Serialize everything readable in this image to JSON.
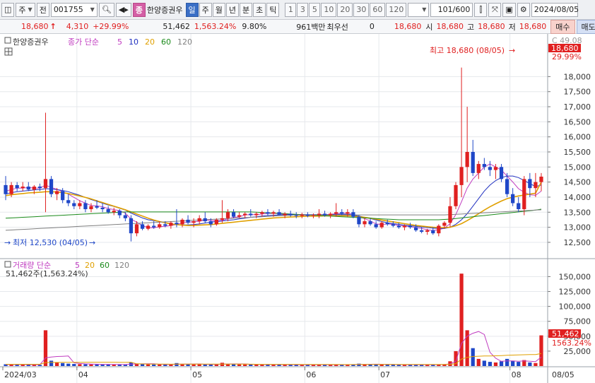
{
  "toolbar": {
    "type_label": "주",
    "period_prefix": "전",
    "code": "001755",
    "name_badge": "종",
    "stock_name": "한양증권우",
    "periods": [
      "일",
      "주",
      "월",
      "년",
      "분",
      "초",
      "틱"
    ],
    "active_period": "일",
    "intervals": [
      "1",
      "3",
      "5",
      "10",
      "20",
      "30",
      "60",
      "120"
    ],
    "count_display": "101/600",
    "date": "2024/08/05"
  },
  "info": {
    "price": "18,680",
    "change": "4,310",
    "change_pct": "+29.99%",
    "volume": "51,462",
    "volume_ratio": "1,563.24%",
    "turnover": "9.80%",
    "amount": "961백만",
    "bid_label": "최우선",
    "bid_value": "0",
    "ask_value": "18,680",
    "open_label": "시",
    "open": "18,680",
    "high_label": "고",
    "high": "18,680",
    "low_label": "저",
    "low": "18,680",
    "buy_button": "매수",
    "sell_button": "매도"
  },
  "price_panel": {
    "title": "한양증권우",
    "ma_label": "종가 단순",
    "ma_periods": [
      "5",
      "10",
      "20",
      "60",
      "120"
    ],
    "ma_colors": [
      "#c03cc0",
      "#2030c0",
      "#e0a000",
      "#1a8a1a",
      "#808080"
    ],
    "high_annotation": "최고 18,680 (08/05)",
    "low_annotation": "최저 12,530 (04/05)",
    "current_price_tag": "18,680",
    "current_pct_tag": "29.99%",
    "top_label": "C 49.08"
  },
  "volume_panel": {
    "ma_label": "거래량 단순",
    "ma_periods": [
      "5",
      "20",
      "60",
      "120"
    ],
    "summary": "51,462주(1,563.24%)",
    "current_volume_tag": "51,462",
    "current_pct_tag": "1563.24%"
  },
  "x_axis": {
    "labels": [
      "2024/03",
      "04",
      "05",
      "06",
      "07",
      "08"
    ],
    "right_label": "08/05"
  },
  "chart_data": {
    "type": "candlestick",
    "price_axis": {
      "ticks": [
        12500,
        13000,
        13500,
        14000,
        14500,
        15000,
        15500,
        16000,
        16500,
        17000,
        17500,
        18000
      ],
      "tick_labels": [
        "12,500",
        "13,000",
        "13,500",
        "14,000",
        "14,500",
        "15,000",
        "15,500",
        "16,000",
        "16,500",
        "17,000",
        "17,500",
        "18,000"
      ],
      "range": [
        12100,
        18900
      ]
    },
    "volume_axis": {
      "ticks": [
        25000,
        50000,
        75000,
        100000,
        125000,
        150000
      ],
      "tick_labels": [
        "25,000",
        "50,000",
        "75,000",
        "100,000",
        "125,000",
        "150,000"
      ],
      "range": [
        0,
        160000
      ]
    },
    "candles": [
      [
        14400,
        14700,
        13900,
        14100
      ],
      [
        14100,
        14500,
        14000,
        14400
      ],
      [
        14400,
        14500,
        14200,
        14300
      ],
      [
        14300,
        14500,
        14200,
        14350
      ],
      [
        14350,
        14500,
        14200,
        14250
      ],
      [
        14250,
        14400,
        14100,
        14350
      ],
      [
        14350,
        14450,
        14200,
        14300
      ],
      [
        14300,
        16800,
        13500,
        14600
      ],
      [
        14600,
        14700,
        14000,
        14100
      ],
      [
        14100,
        14300,
        13900,
        14200
      ],
      [
        14200,
        14300,
        13800,
        13900
      ],
      [
        13900,
        14100,
        13700,
        13800
      ],
      [
        13800,
        13900,
        13600,
        13700
      ],
      [
        13700,
        13900,
        13600,
        13800
      ],
      [
        13800,
        13900,
        13500,
        13600
      ],
      [
        13600,
        13800,
        13500,
        13700
      ],
      [
        13700,
        13900,
        13600,
        13650
      ],
      [
        13650,
        13800,
        13500,
        13600
      ],
      [
        13600,
        13700,
        13450,
        13500
      ],
      [
        13500,
        13650,
        13400,
        13550
      ],
      [
        13550,
        13600,
        13300,
        13400
      ],
      [
        13400,
        13500,
        13200,
        13300
      ],
      [
        13300,
        13400,
        12530,
        12800
      ],
      [
        12800,
        13200,
        12700,
        13100
      ],
      [
        13100,
        13200,
        12900,
        12950
      ],
      [
        12950,
        13100,
        12900,
        13050
      ],
      [
        13050,
        13200,
        12950,
        13000
      ],
      [
        13000,
        13200,
        12950,
        13100
      ],
      [
        13100,
        13200,
        13000,
        13050
      ],
      [
        13050,
        13200,
        12950,
        13150
      ],
      [
        13150,
        13600,
        13000,
        13100
      ],
      [
        13100,
        13300,
        13000,
        13250
      ],
      [
        13250,
        13400,
        13100,
        13150
      ],
      [
        13150,
        13300,
        13000,
        13200
      ],
      [
        13200,
        13400,
        13100,
        13300
      ],
      [
        13300,
        13500,
        13150,
        13200
      ],
      [
        13200,
        13300,
        13000,
        13100
      ],
      [
        13100,
        13300,
        13050,
        13250
      ],
      [
        13250,
        13900,
        13150,
        13300
      ],
      [
        13300,
        13600,
        13200,
        13500
      ],
      [
        13500,
        13600,
        13300,
        13350
      ],
      [
        13350,
        13500,
        13300,
        13400
      ],
      [
        13400,
        13500,
        13300,
        13450
      ],
      [
        13450,
        13600,
        13350,
        13400
      ],
      [
        13400,
        13500,
        13300,
        13450
      ],
      [
        13450,
        13550,
        13350,
        13500
      ],
      [
        13500,
        13600,
        13400,
        13450
      ],
      [
        13450,
        13550,
        13350,
        13500
      ],
      [
        13500,
        13600,
        13400,
        13400
      ],
      [
        13400,
        13500,
        13300,
        13450
      ],
      [
        13450,
        13550,
        13350,
        13400
      ],
      [
        13400,
        13500,
        13300,
        13380
      ],
      [
        13380,
        13480,
        13300,
        13420
      ],
      [
        13420,
        13500,
        13330,
        13380
      ],
      [
        13380,
        13460,
        13300,
        13400
      ],
      [
        13400,
        13600,
        13300,
        13450
      ],
      [
        13450,
        13550,
        13350,
        13400
      ],
      [
        13400,
        13500,
        13300,
        13450
      ],
      [
        13450,
        13800,
        13350,
        13500
      ],
      [
        13500,
        13600,
        13400,
        13450
      ],
      [
        13450,
        13600,
        13350,
        13500
      ],
      [
        13500,
        13600,
        13300,
        13350
      ],
      [
        13350,
        13400,
        13000,
        13100
      ],
      [
        13100,
        13300,
        13000,
        13200
      ],
      [
        13200,
        13300,
        13050,
        13100
      ],
      [
        13100,
        13200,
        12950,
        13000
      ],
      [
        13000,
        13200,
        12950,
        13150
      ],
      [
        13150,
        13250,
        13050,
        13100
      ],
      [
        13100,
        13200,
        13000,
        13050
      ],
      [
        13050,
        13150,
        12950,
        13000
      ],
      [
        13000,
        13100,
        12900,
        13050
      ],
      [
        13050,
        13150,
        12950,
        13000
      ],
      [
        13000,
        13100,
        12850,
        12900
      ],
      [
        12900,
        13000,
        12800,
        12850
      ],
      [
        12850,
        12950,
        12750,
        12900
      ],
      [
        12900,
        13000,
        12750,
        12800
      ],
      [
        12800,
        13100,
        12700,
        13050
      ],
      [
        13050,
        13200,
        12950,
        13150
      ],
      [
        13150,
        14000,
        13000,
        13700
      ],
      [
        13700,
        14500,
        13600,
        14400
      ],
      [
        14400,
        18300,
        14000,
        15000
      ],
      [
        15000,
        17000,
        14500,
        15500
      ],
      [
        15500,
        15900,
        14700,
        14800
      ],
      [
        14800,
        15200,
        14600,
        15100
      ],
      [
        15100,
        15300,
        14900,
        15000
      ],
      [
        15000,
        15200,
        14700,
        14900
      ],
      [
        14900,
        15100,
        14600,
        15000
      ],
      [
        15000,
        15100,
        14500,
        14600
      ],
      [
        14600,
        14800,
        14000,
        14100
      ],
      [
        14100,
        14300,
        13700,
        13800
      ],
      [
        13800,
        14000,
        13500,
        13600
      ],
      [
        13600,
        14700,
        13400,
        14600
      ],
      [
        14600,
        14800,
        14000,
        14300
      ],
      [
        14300,
        14800,
        14000,
        14500
      ],
      [
        14500,
        14800,
        14200,
        14680
      ]
    ],
    "volume": [
      3000,
      2500,
      2200,
      2500,
      2000,
      2200,
      2000,
      60000,
      9000,
      6000,
      5000,
      4000,
      3500,
      3200,
      3000,
      2800,
      3000,
      2600,
      2500,
      2400,
      2600,
      2500,
      6000,
      4000,
      3000,
      2800,
      2700,
      2600,
      2500,
      2600,
      5000,
      3200,
      3000,
      2800,
      2900,
      2700,
      2600,
      2500,
      5500,
      3500,
      3000,
      2800,
      2700,
      2600,
      2500,
      2400,
      2600,
      2500,
      2400,
      2300,
      2400,
      2300,
      2200,
      2300,
      2200,
      2400,
      2300,
      2200,
      2500,
      2300,
      2200,
      3000,
      4000,
      3000,
      2800,
      2600,
      2500,
      2400,
      2300,
      2200,
      2300,
      2200,
      2500,
      2400,
      2300,
      2200,
      2600,
      3000,
      8000,
      25000,
      155000,
      60000,
      30000,
      12000,
      9000,
      7000,
      6000,
      8000,
      12000,
      9000,
      7000,
      10000,
      6000,
      5000,
      51462
    ],
    "ma5": [
      14200,
      14250,
      14300,
      14300,
      14320,
      14300,
      14300,
      14400,
      14320,
      14260,
      14180,
      14100,
      13990,
      13880,
      13800,
      13720,
      13710,
      13680,
      13620,
      13590,
      13550,
      13470,
      13270,
      13170,
      13050,
      12990,
      12980,
      13020,
      13030,
      13060,
      13090,
      13150,
      13170,
      13180,
      13200,
      13240,
      13230,
      13210,
      13230,
      13280,
      13330,
      13350,
      13410,
      13420,
      13420,
      13440,
      13460,
      13460,
      13450,
      13430,
      13430,
      13410,
      13400,
      13400,
      13400,
      13410,
      13420,
      13430,
      13450,
      13460,
      13470,
      13430,
      13350,
      13290,
      13210,
      13110,
      13090,
      13110,
      13100,
      13060,
      13040,
      13020,
      12990,
      12960,
      12920,
      12890,
      12920,
      12970,
      13120,
      13420,
      13850,
      14300,
      14600,
      14800,
      15000,
      15100,
      15000,
      14900,
      14700,
      14500,
      14280,
      14160,
      14080,
      14060,
      14200
    ],
    "ma10": [
      14100,
      14150,
      14180,
      14200,
      14220,
      14240,
      14250,
      14280,
      14270,
      14250,
      14220,
      14180,
      14120,
      14060,
      13990,
      13920,
      13860,
      13800,
      13740,
      13690,
      13630,
      13570,
      13470,
      13390,
      13310,
      13250,
      13220,
      13190,
      13150,
      13120,
      13090,
      13080,
      13080,
      13090,
      13110,
      13140,
      13170,
      13190,
      13210,
      13230,
      13250,
      13280,
      13300,
      13330,
      13350,
      13370,
      13390,
      13400,
      13410,
      13420,
      13420,
      13420,
      13420,
      13420,
      13420,
      13420,
      13420,
      13420,
      13430,
      13430,
      13430,
      13410,
      13370,
      13330,
      13290,
      13240,
      13190,
      13150,
      13120,
      13100,
      13070,
      13050,
      13030,
      13010,
      12990,
      12970,
      12960,
      12960,
      13000,
      13100,
      13250,
      13450,
      13700,
      13950,
      14200,
      14400,
      14550,
      14650,
      14700,
      14700,
      14650,
      14550,
      14450,
      14350,
      14400
    ],
    "ma20": [
      14050,
      14080,
      14100,
      14120,
      14140,
      14150,
      14160,
      14180,
      14180,
      14170,
      14150,
      14120,
      14080,
      14040,
      13990,
      13940,
      13880,
      13820,
      13760,
      13700,
      13640,
      13580,
      13510,
      13440,
      13370,
      13300,
      13240,
      13190,
      13150,
      13110,
      13090,
      13070,
      13060,
      13060,
      13070,
      13080,
      13090,
      13110,
      13130,
      13150,
      13170,
      13190,
      13210,
      13230,
      13250,
      13270,
      13290,
      13310,
      13320,
      13330,
      13340,
      13350,
      13360,
      13370,
      13370,
      13370,
      13380,
      13380,
      13380,
      13380,
      13380,
      13370,
      13350,
      13330,
      13300,
      13270,
      13240,
      13210,
      13180,
      13150,
      13120,
      13090,
      13060,
      13040,
      13020,
      13000,
      12990,
      12990,
      13000,
      13050,
      13120,
      13220,
      13330,
      13450,
      13570,
      13680,
      13780,
      13870,
      13950,
      14000,
      14040,
      14070,
      14100,
      14130,
      14500
    ],
    "ma60": [
      13300,
      13310,
      13320,
      13330,
      13340,
      13350,
      13360,
      13370,
      13380,
      13390,
      13400,
      13410,
      13420,
      13430,
      13440,
      13450,
      13460,
      13470,
      13480,
      13490,
      13500,
      13510,
      13510,
      13510,
      13510,
      13510,
      13510,
      13510,
      13510,
      13510,
      13510,
      13510,
      13510,
      13510,
      13510,
      13510,
      13510,
      13510,
      13510,
      13510,
      13510,
      13510,
      13510,
      13510,
      13500,
      13490,
      13480,
      13470,
      13460,
      13450,
      13440,
      13430,
      13420,
      13410,
      13400,
      13390,
      13380,
      13370,
      13360,
      13350,
      13340,
      13330,
      13320,
      13310,
      13300,
      13290,
      13280,
      13270,
      13260,
      13250,
      13250,
      13250,
      13250,
      13250,
      13250,
      13250,
      13250,
      13260,
      13270,
      13290,
      13310,
      13330,
      13350,
      13370,
      13390,
      13410,
      13430,
      13450,
      13470,
      13490,
      13510,
      13530,
      13550,
      13570,
      13600
    ],
    "ma120": [
      12900,
      12910,
      12920,
      12930,
      12940,
      12950,
      12960,
      12970,
      12980,
      12990,
      13000,
      13010,
      13020,
      13030,
      13040,
      13050,
      13060,
      13070,
      13080,
      13090,
      13100,
      13110,
      13120,
      13130,
      13140,
      13150,
      13160,
      13170,
      13180,
      13190,
      13200,
      13210,
      13220,
      13230,
      13240,
      13250,
      13260,
      13270,
      13280,
      13290,
      13300,
      13310,
      13320,
      13330,
      13340,
      13350,
      13360,
      13370,
      13380,
      13390,
      13400,
      13410,
      13410,
      13410,
      13410,
      13410,
      13410,
      13410,
      13410,
      13410,
      13410,
      13410,
      13410,
      13410,
      13410,
      13410,
      13410,
      13410,
      13410,
      13410,
      13410,
      13410,
      13410,
      13410,
      13410,
      13410,
      13410,
      13410,
      13420,
      13430,
      13440,
      13450,
      13460,
      13470,
      13480,
      13490,
      13500,
      13510,
      13520,
      13530,
      13540,
      13550,
      13560,
      13570,
      13580
    ],
    "vol_ma5": [
      2500,
      2500,
      2500,
      2500,
      2400,
      2300,
      2200,
      13700,
      15000,
      16000,
      16400,
      16800,
      5500,
      4300,
      3700,
      3300,
      3100,
      2900,
      2800,
      2700,
      2600,
      2500,
      3200,
      3500,
      3700,
      3900,
      3800,
      3000,
      2700,
      2600,
      3000,
      3200,
      3300,
      3400,
      3500,
      2900,
      2800,
      2700,
      3300,
      3400,
      3500,
      3500,
      3500,
      2800,
      2700,
      2600,
      2500,
      2500,
      2500,
      2400,
      2400,
      2300,
      2300,
      2300,
      2300,
      2300,
      2300,
      2300,
      2300,
      2300,
      2300,
      2400,
      2800,
      2900,
      3000,
      3100,
      3000,
      2800,
      2600,
      2400,
      2300,
      2300,
      2300,
      2300,
      2300,
      2300,
      2400,
      2600,
      3500,
      7800,
      38000,
      50000,
      55000,
      58000,
      53000,
      23000,
      13000,
      8000,
      8500,
      8500,
      8000,
      8500,
      8000,
      7500,
      15000
    ],
    "vol_ma20": [
      3000,
      3000,
      3000,
      3000,
      3000,
      3000,
      3000,
      5800,
      6000,
      6100,
      6200,
      6300,
      6300,
      6300,
      6400,
      6400,
      6400,
      6400,
      6400,
      6400,
      6300,
      6300,
      6400,
      3800,
      3500,
      3300,
      3200,
      3200,
      3200,
      3100,
      3200,
      3200,
      3200,
      3200,
      3200,
      3200,
      3200,
      3200,
      3300,
      3300,
      3300,
      3300,
      3200,
      3100,
      3000,
      2900,
      2900,
      2900,
      2900,
      2800,
      2800,
      2800,
      2700,
      2700,
      2600,
      2600,
      2600,
      2600,
      2600,
      2500,
      2500,
      2500,
      2600,
      2600,
      2600,
      2600,
      2600,
      2600,
      2600,
      2600,
      2600,
      2600,
      2600,
      2600,
      2600,
      2600,
      2600,
      2600,
      2900,
      4000,
      11700,
      14600,
      16000,
      16500,
      16800,
      17000,
      17200,
      17500,
      18000,
      18400,
      18700,
      19000,
      19200,
      19300,
      21000
    ]
  }
}
